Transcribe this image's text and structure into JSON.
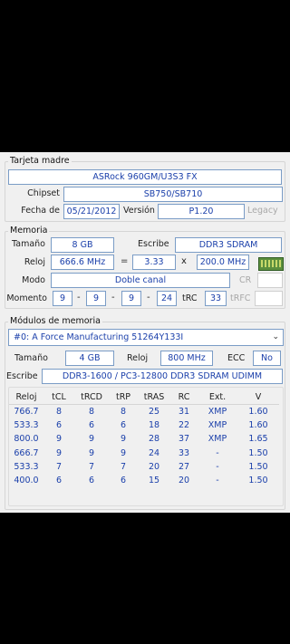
{
  "mobo": {
    "title": "Tarjeta madre",
    "model": "ASRock 960GM/U3S3 FX",
    "chipset_label": "Chipset",
    "chipset": "SB750/SB710",
    "date_label": "Fecha de",
    "date": "05/21/2012",
    "version_label": "Versión",
    "version": "P1.20",
    "legacy": "Legacy"
  },
  "memory": {
    "title": "Memoria",
    "size_label": "Tamaño",
    "size": "8 GB",
    "type_label": "Escribe",
    "type": "DDR3 SDRAM",
    "clock_label": "Reloj",
    "clock": "666.6 MHz",
    "eq": "=",
    "mult": "3.33",
    "x": "x",
    "bus": "200.0 MHz",
    "mode_label": "Modo",
    "mode": "Doble canal",
    "cr": "CR",
    "timing_label": "Momento",
    "t1": "9",
    "t2": "9",
    "t3": "9",
    "t4": "24",
    "dash": "-",
    "trc_label": "tRC",
    "trc": "33",
    "trfc_label": "tRFC"
  },
  "modules": {
    "title": "Módulos de memoria",
    "selected": "#0: A Force Manufacturing 51264Y133I",
    "size_label": "Tamaño",
    "size": "4 GB",
    "clock_label": "Reloj",
    "clock": "800 MHz",
    "ecc_label": "ECC",
    "ecc": "No",
    "type_label": "Escribe",
    "type": "DDR3-1600 / PC3-12800 DDR3 SDRAM UDIMM"
  },
  "timings": {
    "headers": [
      "Reloj",
      "tCL",
      "tRCD",
      "tRP",
      "tRAS",
      "RC",
      "Ext.",
      "V"
    ],
    "rows": [
      [
        "766.7",
        "8",
        "8",
        "8",
        "25",
        "31",
        "XMP",
        "1.60"
      ],
      [
        "533.3",
        "6",
        "6",
        "6",
        "18",
        "22",
        "XMP",
        "1.60"
      ],
      [
        "800.0",
        "9",
        "9",
        "9",
        "28",
        "37",
        "XMP",
        "1.65"
      ],
      [
        "666.7",
        "9",
        "9",
        "9",
        "24",
        "33",
        "-",
        "1.50"
      ],
      [
        "533.3",
        "7",
        "7",
        "7",
        "20",
        "27",
        "-",
        "1.50"
      ],
      [
        "400.0",
        "6",
        "6",
        "6",
        "15",
        "20",
        "-",
        "1.50"
      ]
    ]
  },
  "icons": {
    "ram": "ram-stick-icon",
    "dropdown": "chevron-down-icon"
  }
}
